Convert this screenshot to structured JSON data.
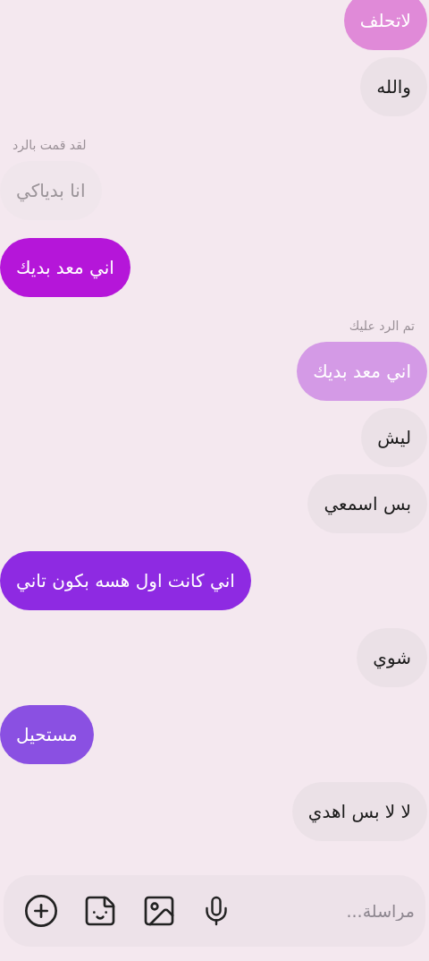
{
  "messages": [
    {
      "kind": "quote",
      "outgoing": false,
      "text": "لاتحلف",
      "color": "#e08ad8"
    },
    {
      "kind": "received",
      "outgoing": false,
      "text": "والله"
    },
    {
      "kind": "reply_label",
      "outgoing": true,
      "text": "لقد قمت بالرد"
    },
    {
      "kind": "quote",
      "outgoing": true,
      "text": "انا بدياكي",
      "color": "#f0e6ec"
    },
    {
      "kind": "sent",
      "outgoing": true,
      "text": "اني معد بديك",
      "color": "#b516d9"
    },
    {
      "kind": "reply_label",
      "outgoing": false,
      "text": "تم الرد عليك"
    },
    {
      "kind": "quote",
      "outgoing": false,
      "text": "اني معد بديك",
      "color": "#d49ae6"
    },
    {
      "kind": "received",
      "outgoing": false,
      "text": "ليش"
    },
    {
      "kind": "received",
      "outgoing": false,
      "text": "بس اسمعي"
    },
    {
      "kind": "sent",
      "outgoing": true,
      "text": "اني كانت اول هسه بكون تاني",
      "color": "#8e2ae2"
    },
    {
      "kind": "received",
      "outgoing": false,
      "text": "شوي"
    },
    {
      "kind": "sent",
      "outgoing": true,
      "text": "مستحيل",
      "color": "#8a50e2"
    },
    {
      "kind": "received",
      "outgoing": false,
      "text": "لا لا بس اهدي"
    }
  ],
  "composer": {
    "placeholder": "مراسلة..."
  }
}
